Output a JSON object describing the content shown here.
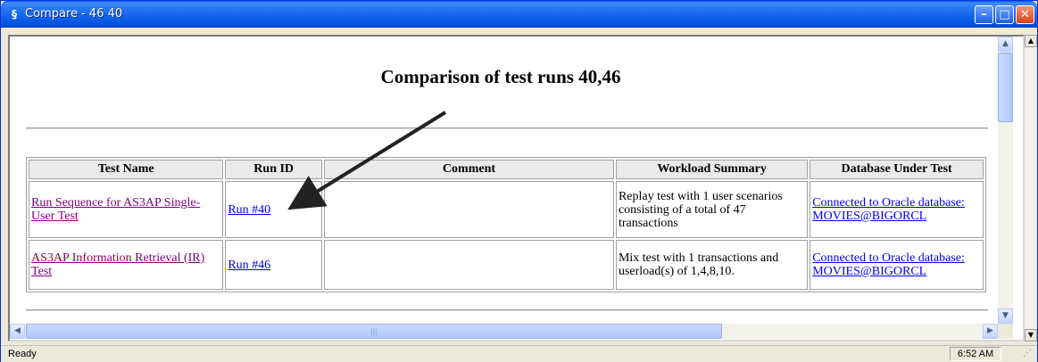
{
  "window": {
    "title": "Compare - 46 40",
    "icon": "app-icon"
  },
  "page": {
    "title": "Comparison of test runs 40,46",
    "columns": [
      "Test Name",
      "Run ID",
      "Comment",
      "Workload Summary",
      "Database Under Test"
    ],
    "rows": [
      {
        "test_name": "Run Sequence for AS3AP Single-User Test",
        "run_id": "Run #40",
        "comment": "",
        "workload": "Replay test with 1 user scenarios consisting of a total of 47 transactions",
        "database": "Connected to Oracle database: MOVIES@BIGORCL"
      },
      {
        "test_name": "AS3AP Information Retrieval (IR) Test",
        "run_id": "Run #46",
        "comment": "",
        "workload": "Mix test with 1 transactions and userload(s) of 1,4,8,10.",
        "database": "Connected to Oracle database: MOVIES@BIGORCL"
      }
    ]
  },
  "status": {
    "text": "Ready",
    "clock": "6:52 AM"
  },
  "colors": {
    "visited_link": "#800080",
    "link": "#0000ee",
    "titlebar": "#0053e1"
  }
}
